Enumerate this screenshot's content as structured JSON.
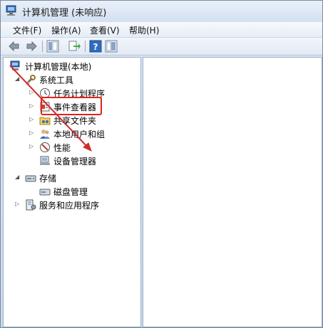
{
  "window": {
    "title": "计算机管理 (未响应)"
  },
  "menu": [
    {
      "label": "文件(F)"
    },
    {
      "label": "操作(A)"
    },
    {
      "label": "查看(V)"
    },
    {
      "label": "帮助(H)"
    }
  ],
  "toolbar": {
    "buttons": [
      "back-arrow-icon",
      "forward-arrow-icon",
      "show-hide-tree-icon",
      "export-list-icon",
      "help-icon",
      "properties-icon"
    ]
  },
  "tree": {
    "root": "计算机管理(本地)",
    "system_tools": "系统工具",
    "task_scheduler": "任务计划程序",
    "event_viewer": "事件查看器",
    "shared_folders": "共享文件夹",
    "local_users": "本地用户和组",
    "performance": "性能",
    "device_manager": "设备管理器",
    "storage": "存储",
    "disk_management": "磁盘管理",
    "services_apps": "服务和应用程序"
  },
  "annotation": {
    "highlight_color": "#e2231a",
    "arrow_color": "#d02a2a"
  }
}
